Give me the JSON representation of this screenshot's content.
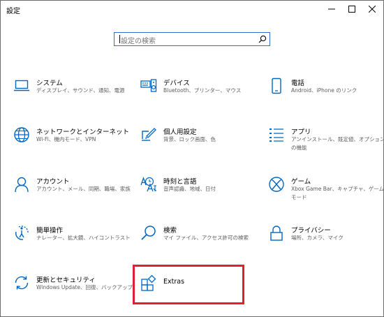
{
  "window": {
    "title": "設定"
  },
  "search": {
    "placeholder": "設定の検索"
  },
  "tiles": [
    {
      "title": "システム",
      "desc": "ディスプレイ、サウンド、通知、電源",
      "icon": "laptop-icon"
    },
    {
      "title": "デバイス",
      "desc": "Bluetooth、プリンター、マウス",
      "icon": "keyboard-speaker-icon"
    },
    {
      "title": "電話",
      "desc": "Android、iPhone のリンク",
      "icon": "phone-icon"
    },
    {
      "title": "ネットワークとインターネット",
      "desc": "Wi-Fi、機内モード、VPN",
      "icon": "globe-icon"
    },
    {
      "title": "個人用設定",
      "desc": "背景、ロック画面、色",
      "icon": "paint-brush-icon"
    },
    {
      "title": "アプリ",
      "desc": "アンインストール、既定値、オプションの機能",
      "icon": "apps-list-icon"
    },
    {
      "title": "アカウント",
      "desc": "アカウント、メール、同期、職場、家族",
      "icon": "person-icon"
    },
    {
      "title": "時刻と言語",
      "desc": "音声認識、地域、日付",
      "icon": "time-language-icon"
    },
    {
      "title": "ゲーム",
      "desc": "Xbox Game Bar、キャプチャ、ゲーム モード",
      "icon": "xbox-icon"
    },
    {
      "title": "簡単操作",
      "desc": "ナレーター、拡大鏡、ハイコントラスト",
      "icon": "ease-of-access-icon"
    },
    {
      "title": "検索",
      "desc": "マイ ファイル、アクセス許可の検索",
      "icon": "search-magnifier-icon"
    },
    {
      "title": "プライバシー",
      "desc": "場所、カメラ、マイク",
      "icon": "lock-icon"
    },
    {
      "title": "更新とセキュリティ",
      "desc": "Windows Update、回復、バックアップ",
      "icon": "sync-icon"
    },
    {
      "title": "Extras",
      "desc": "",
      "icon": "extras-icon"
    }
  ],
  "colors": {
    "accent": "#0067c0",
    "highlight": "#e0202c"
  }
}
